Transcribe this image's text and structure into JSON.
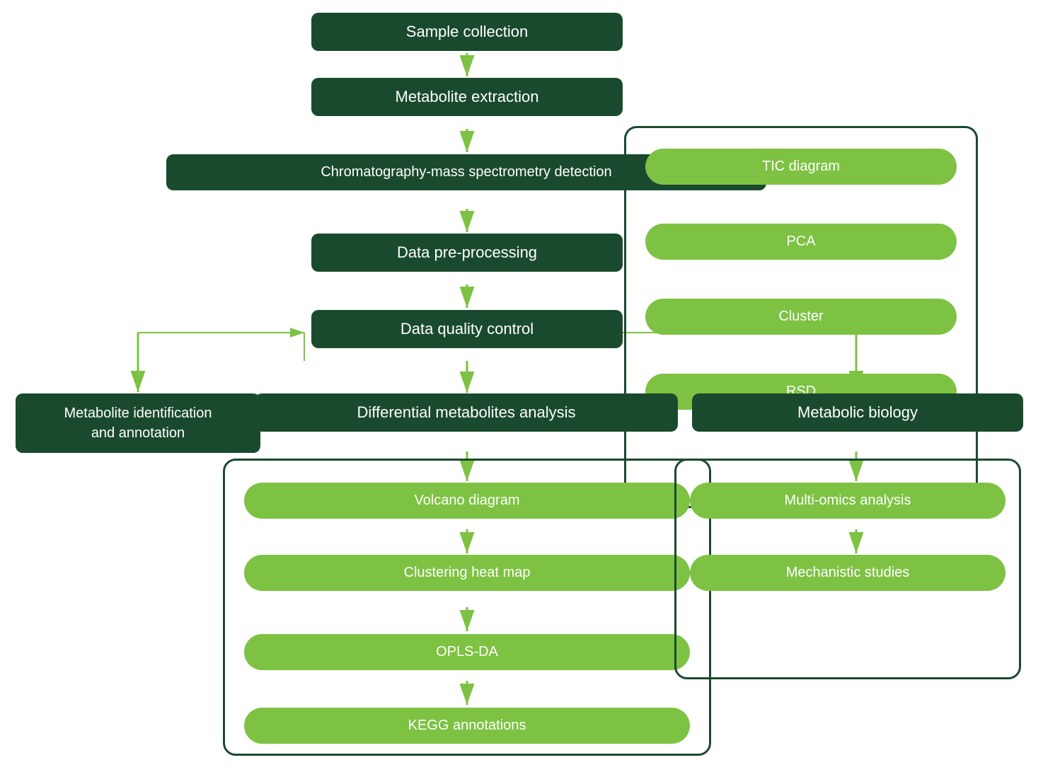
{
  "nodes": {
    "sample_collection": "Sample collection",
    "metabolite_extraction": "Metabolite extraction",
    "chromatography": "Chromatography-mass spectrometry detection",
    "data_preprocessing": "Data pre-processing",
    "data_quality": "Data quality control",
    "metabolite_id": "Metabolite identification\nand annotation",
    "differential": "Differential metabolites analysis",
    "metabolic_biology": "Metabolic biology",
    "tic_diagram": "TIC diagram",
    "pca": "PCA",
    "cluster": "Cluster",
    "rsd": "RSD",
    "volcano": "Volcano diagram",
    "clustering_heatmap": "Clustering heat map",
    "opls_da": "OPLS-DA",
    "kegg": "KEGG annotations",
    "multi_omics": "Multi-omics analysis",
    "mechanistic": "Mechanistic studies"
  },
  "colors": {
    "dark_green": "#1a4a2e",
    "light_green": "#7dc242",
    "arrow_green": "#7dc242",
    "border_dark": "#1a4a2e"
  }
}
